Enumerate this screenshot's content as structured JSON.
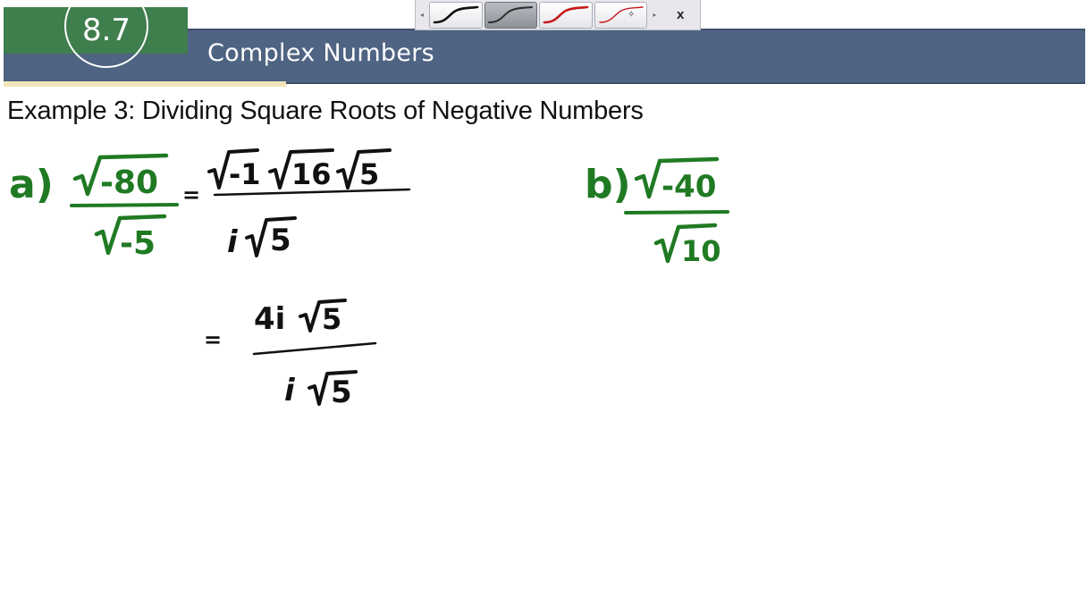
{
  "header": {
    "section_number": "8.7",
    "section_title": "Complex Numbers"
  },
  "toolbar": {
    "pens": [
      {
        "name": "black-pen",
        "color": "#111111"
      },
      {
        "name": "gray-pen",
        "color": "#333333",
        "selected": true
      },
      {
        "name": "red-pen",
        "color": "#c8191b"
      },
      {
        "name": "red-point-pen",
        "color": "#c8191b"
      }
    ],
    "close_label": "x"
  },
  "example": {
    "heading": "Example 3:  Dividing Square Roots of Negative Numbers"
  },
  "handwriting": {
    "ink_color_green": "#207a23",
    "ink_color_black": "#111111",
    "part_a": {
      "label": "a)",
      "numerator_radicand": "-80",
      "denominator_radicand": "-5",
      "step1_numerator": [
        "-1",
        "16",
        "5"
      ],
      "step1_denominator_prefix": "i",
      "step1_denominator_radicand": "5",
      "step2_numerator_prefix": "4i",
      "step2_numerator_radicand": "5",
      "step2_denominator_prefix": "i",
      "step2_denominator_radicand": "5",
      "equals": "="
    },
    "part_b": {
      "label": "b)",
      "numerator_radicand": "-40",
      "denominator_radicand": "10"
    }
  }
}
